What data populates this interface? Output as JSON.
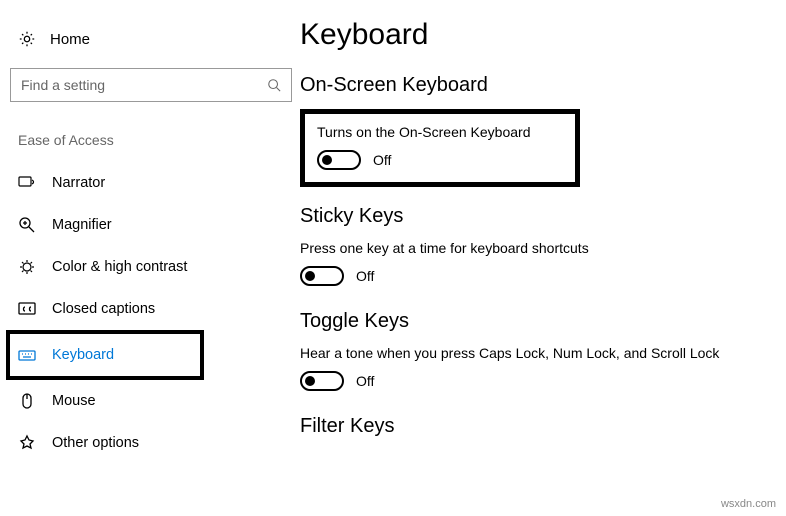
{
  "sidebar": {
    "home": "Home",
    "search_placeholder": "Find a setting",
    "category": "Ease of Access",
    "items": [
      {
        "label": "Narrator"
      },
      {
        "label": "Magnifier"
      },
      {
        "label": "Color & high contrast"
      },
      {
        "label": "Closed captions"
      },
      {
        "label": "Keyboard"
      },
      {
        "label": "Mouse"
      },
      {
        "label": "Other options"
      }
    ]
  },
  "main": {
    "title": "Keyboard",
    "onscreen": {
      "heading": "On-Screen Keyboard",
      "desc": "Turns on the On-Screen Keyboard",
      "state": "Off"
    },
    "sticky": {
      "heading": "Sticky Keys",
      "desc": "Press one key at a time for keyboard shortcuts",
      "state": "Off"
    },
    "toggle_keys": {
      "heading": "Toggle Keys",
      "desc": "Hear a tone when you press Caps Lock, Num Lock, and Scroll Lock",
      "state": "Off"
    },
    "filter": {
      "heading": "Filter Keys"
    }
  },
  "watermark": "wsxdn.com"
}
